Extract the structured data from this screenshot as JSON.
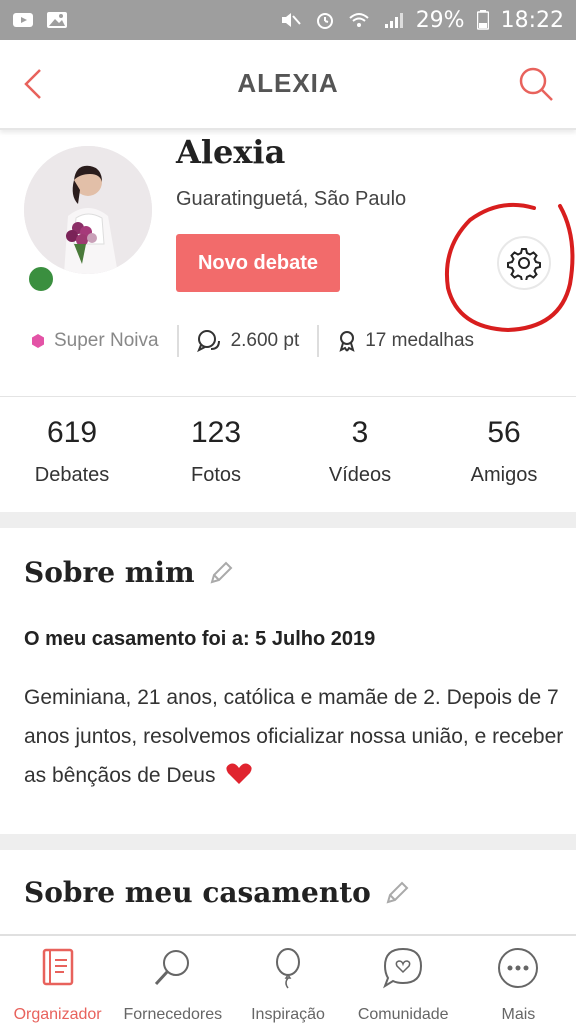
{
  "status_bar": {
    "battery": "29%",
    "time": "18:22"
  },
  "header": {
    "title": "ALEXIA"
  },
  "profile": {
    "name": "Alexia",
    "location": "Guaratinguetá, São Paulo",
    "new_debate_button": "Novo debate",
    "badges": {
      "level": "Super Noiva",
      "points": "2.600 pt",
      "medals": "17 medalhas"
    }
  },
  "stats": [
    {
      "value": "619",
      "label": "Debates"
    },
    {
      "value": "123",
      "label": "Fotos"
    },
    {
      "value": "3",
      "label": "Vídeos"
    },
    {
      "value": "56",
      "label": "Amigos"
    }
  ],
  "about": {
    "title": "Sobre mim",
    "wedding_date": "O meu casamento foi a: 5 Julho 2019",
    "text": "Geminiana, 21 anos, católica e mamãe de 2. Depois de 7 anos juntos, resolvemos oficializar nossa união, e receber as bênçãos de Deus"
  },
  "wedding_section": {
    "title": "Sobre meu casamento"
  },
  "bottom_nav": [
    {
      "label": "Organizador",
      "icon": "planner-icon",
      "active": true
    },
    {
      "label": "Fornecedores",
      "icon": "search-icon"
    },
    {
      "label": "Inspiração",
      "icon": "balloon-icon"
    },
    {
      "label": "Comunidade",
      "icon": "chat-heart-icon"
    },
    {
      "label": "Mais",
      "icon": "more-icon"
    }
  ],
  "colors": {
    "accent": "#f26b6b",
    "nav_active": "#e8625c",
    "online": "#3a8f3f",
    "annotation": "#d81e1e"
  }
}
